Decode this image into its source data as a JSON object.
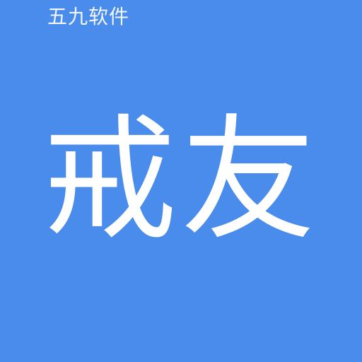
{
  "watermark": {
    "text": "五九软件"
  },
  "app_icon": {
    "name": "戒友",
    "background_color": "#4a8cec",
    "text_color": "#ffffff"
  }
}
